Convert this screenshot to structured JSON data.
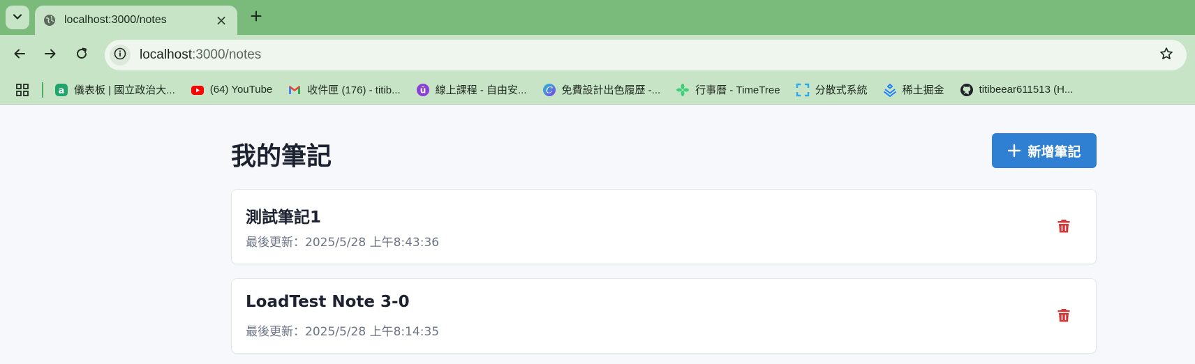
{
  "browser": {
    "tab": {
      "title": "localhost:3000/notes",
      "close_glyph": "×"
    },
    "new_tab_icon": "plus-icon",
    "address": {
      "host": "localhost",
      "path": ":3000/notes"
    },
    "bookmarks": [
      {
        "label": "儀表板 | 國立政治大...",
        "icon": "moodle-icon",
        "color": "#1fa56b"
      },
      {
        "label": "(64) YouTube",
        "icon": "youtube-icon",
        "color": "#ff0000"
      },
      {
        "label": "收件匣 (176) - titib...",
        "icon": "gmail-icon",
        "color": "#ea4335"
      },
      {
        "label": "線上課程 - 自由安...",
        "icon": "course-icon",
        "color": "#8b3fd9"
      },
      {
        "label": "免費設計出色履歷 -...",
        "icon": "canva-icon",
        "color": "#2b7de9"
      },
      {
        "label": "行事曆 - TimeTree",
        "icon": "timetree-icon",
        "color": "#3fcf7a"
      },
      {
        "label": "分散式系統",
        "icon": "distributed-icon",
        "color": "#2aa8f0"
      },
      {
        "label": "稀土掘金",
        "icon": "juejin-icon",
        "color": "#1e80ff"
      },
      {
        "label": "titibeear611513 (H...",
        "icon": "github-icon",
        "color": "#1f2328"
      }
    ]
  },
  "page": {
    "title": "我的筆記",
    "add_button_label": "新增筆記",
    "notes": [
      {
        "title": "測試筆記1",
        "updated": "最後更新：2025/5/28 上午8:43:36"
      },
      {
        "title": "LoadTest Note 3-0",
        "updated": "最後更新：2025/5/28 上午8:14:35"
      }
    ]
  },
  "colors": {
    "tabstrip": "#7abb7b",
    "toolbar": "#c8e4c6",
    "primary_button": "#2f7fd3",
    "delete": "#d43838"
  }
}
